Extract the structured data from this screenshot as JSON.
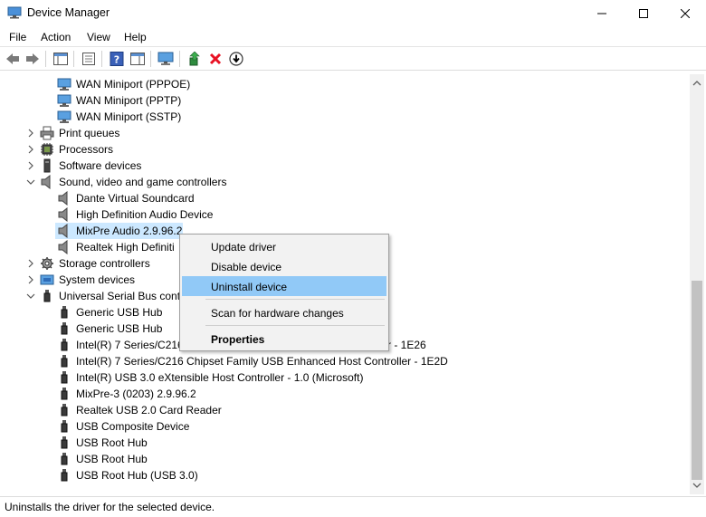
{
  "window": {
    "title": "Device Manager"
  },
  "menu": [
    "File",
    "Action",
    "View",
    "Help"
  ],
  "tree": [
    {
      "label": "WAN Miniport (PPPOE)",
      "icon": "network-adapter-icon",
      "level": 2
    },
    {
      "label": "WAN Miniport (PPTP)",
      "icon": "network-adapter-icon",
      "level": 2
    },
    {
      "label": "WAN Miniport (SSTP)",
      "icon": "network-adapter-icon",
      "level": 2
    },
    {
      "label": "Print queues",
      "icon": "printer-icon",
      "level": 1,
      "expanded": false
    },
    {
      "label": "Processors",
      "icon": "processor-icon",
      "level": 1,
      "expanded": false
    },
    {
      "label": "Software devices",
      "icon": "software-device-icon",
      "level": 1,
      "expanded": false
    },
    {
      "label": "Sound, video and game controllers",
      "icon": "speaker-icon",
      "level": 1,
      "expanded": true
    },
    {
      "label": "Dante Virtual Soundcard",
      "icon": "speaker-icon",
      "level": 2
    },
    {
      "label": "High Definition Audio Device",
      "icon": "speaker-icon",
      "level": 2
    },
    {
      "label": "MixPre Audio 2.9.96.2",
      "icon": "speaker-icon",
      "level": 2,
      "selected": true
    },
    {
      "label": "Realtek High Definiti",
      "icon": "speaker-icon",
      "level": 2
    },
    {
      "label": "Storage controllers",
      "icon": "storage-controller-icon",
      "level": 1,
      "expanded": false
    },
    {
      "label": "System devices",
      "icon": "system-device-icon",
      "level": 1,
      "expanded": false
    },
    {
      "label": "Universal Serial Bus contr",
      "icon": "usb-icon",
      "level": 1,
      "expanded": true
    },
    {
      "label": "Generic USB Hub",
      "icon": "usb-icon",
      "level": 2
    },
    {
      "label": "Generic USB Hub",
      "icon": "usb-icon",
      "level": 2
    },
    {
      "label": "Intel(R) 7 Series/C216",
      "tail": "r - 1E26",
      "icon": "usb-icon",
      "level": 2
    },
    {
      "label": "Intel(R) 7 Series/C216 Chipset Family USB Enhanced Host Controller - 1E2D",
      "icon": "usb-icon",
      "level": 2
    },
    {
      "label": "Intel(R) USB 3.0 eXtensible Host Controller - 1.0 (Microsoft)",
      "icon": "usb-icon",
      "level": 2
    },
    {
      "label": "MixPre-3 (0203) 2.9.96.2",
      "icon": "usb-icon",
      "level": 2
    },
    {
      "label": "Realtek USB 2.0 Card Reader",
      "icon": "usb-icon",
      "level": 2
    },
    {
      "label": "USB Composite Device",
      "icon": "usb-icon",
      "level": 2
    },
    {
      "label": "USB Root Hub",
      "icon": "usb-icon",
      "level": 2
    },
    {
      "label": "USB Root Hub",
      "icon": "usb-icon",
      "level": 2
    },
    {
      "label": "USB Root Hub (USB 3.0)",
      "icon": "usb-icon",
      "level": 2
    }
  ],
  "context_menu": [
    {
      "label": "Update driver"
    },
    {
      "label": "Disable device"
    },
    {
      "label": "Uninstall device",
      "highlighted": true
    },
    {
      "label": "Scan for hardware changes"
    },
    {
      "label": "Properties",
      "bold": true
    }
  ],
  "status": "Uninstalls the driver for the selected device.",
  "colors": {
    "selection": "#cce8ff",
    "menu_highlight": "#91c9f7",
    "delete_red": "#e81123"
  }
}
